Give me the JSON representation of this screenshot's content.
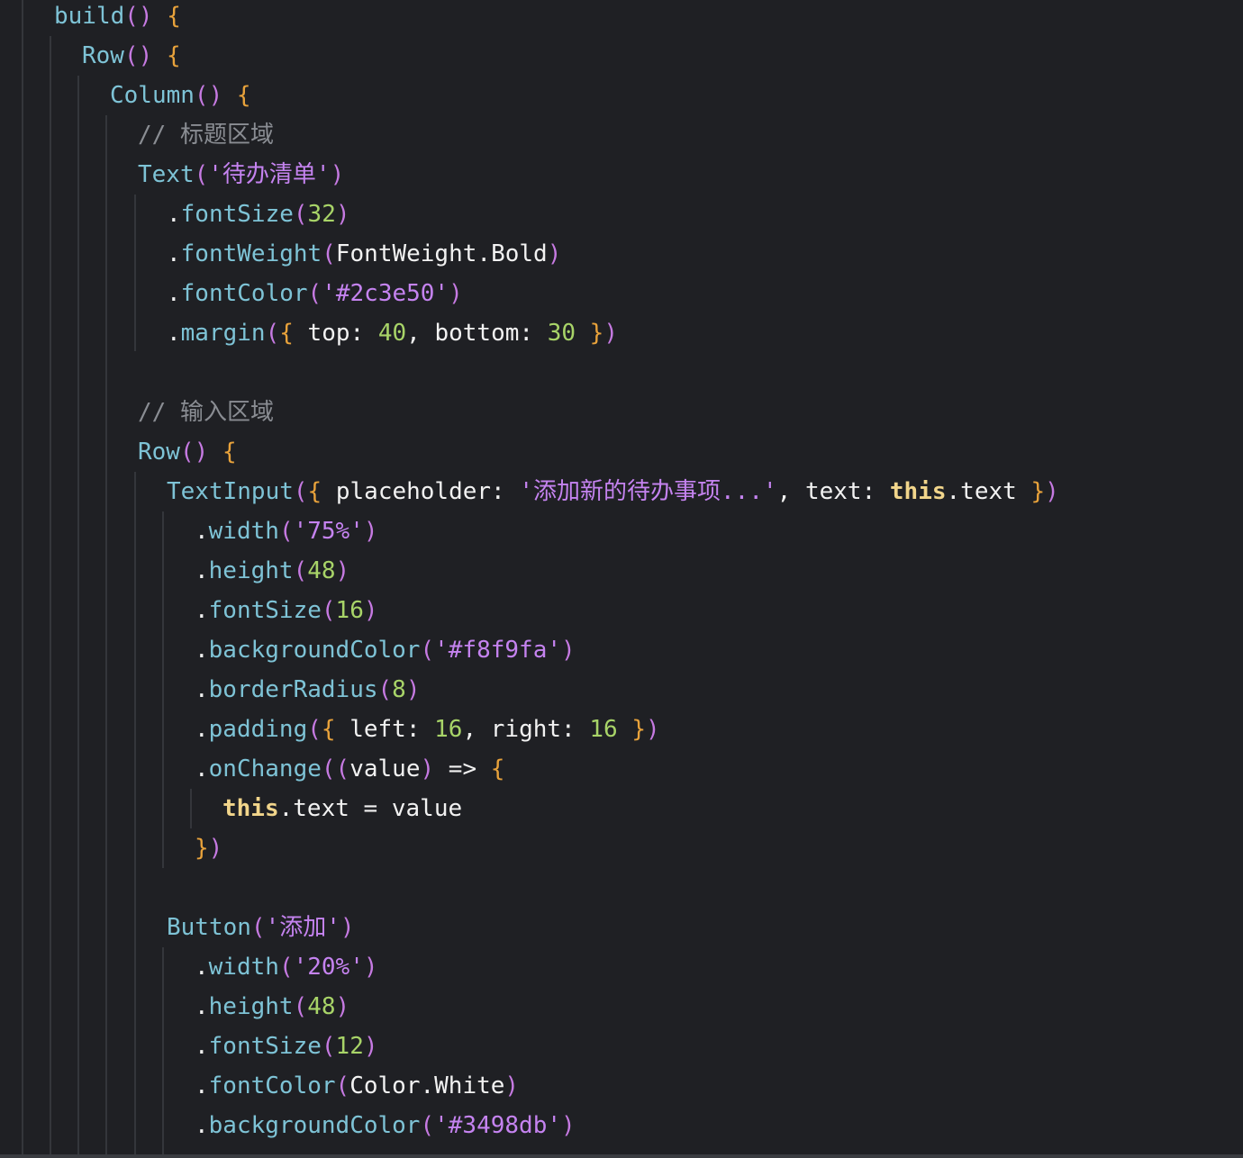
{
  "code_lines": [
    {
      "t": [
        [
          "fn",
          "build"
        ],
        [
          "par",
          "()"
        ],
        [
          "pun",
          " "
        ],
        [
          "br",
          "{"
        ]
      ]
    },
    {
      "t": [
        [
          "fn",
          "Row"
        ],
        [
          "par",
          "()"
        ],
        [
          "pun",
          " "
        ],
        [
          "br",
          "{"
        ]
      ]
    },
    {
      "t": [
        [
          "fn",
          "Column"
        ],
        [
          "par",
          "()"
        ],
        [
          "pun",
          " "
        ],
        [
          "br",
          "{"
        ]
      ]
    },
    {
      "t": [
        [
          "cmt",
          "// 标题区域"
        ]
      ]
    },
    {
      "t": [
        [
          "fn",
          "Text"
        ],
        [
          "par",
          "("
        ],
        [
          "str",
          "'待办清单'"
        ],
        [
          "par",
          ")"
        ]
      ]
    },
    {
      "t": [
        [
          "pun",
          "."
        ],
        [
          "mth",
          "fontSize"
        ],
        [
          "par",
          "("
        ],
        [
          "num",
          "32"
        ],
        [
          "par",
          ")"
        ]
      ]
    },
    {
      "t": [
        [
          "pun",
          "."
        ],
        [
          "mth",
          "fontWeight"
        ],
        [
          "par",
          "("
        ],
        [
          "id",
          "FontWeight"
        ],
        [
          "pun",
          "."
        ],
        [
          "id",
          "Bold"
        ],
        [
          "par",
          ")"
        ]
      ]
    },
    {
      "t": [
        [
          "pun",
          "."
        ],
        [
          "mth",
          "fontColor"
        ],
        [
          "par",
          "("
        ],
        [
          "str",
          "'#2c3e50'"
        ],
        [
          "par",
          ")"
        ]
      ]
    },
    {
      "t": [
        [
          "pun",
          "."
        ],
        [
          "mth",
          "margin"
        ],
        [
          "par",
          "("
        ],
        [
          "br",
          "{"
        ],
        [
          "id",
          " top"
        ],
        [
          "pun",
          ": "
        ],
        [
          "num",
          "40"
        ],
        [
          "pun",
          ", "
        ],
        [
          "id",
          "bottom"
        ],
        [
          "pun",
          ": "
        ],
        [
          "num",
          "30"
        ],
        [
          "pun",
          " "
        ],
        [
          "br",
          "}"
        ],
        [
          "par",
          ")"
        ]
      ]
    },
    {
      "t": []
    },
    {
      "t": [
        [
          "cmt",
          "// 输入区域"
        ]
      ]
    },
    {
      "t": [
        [
          "fn",
          "Row"
        ],
        [
          "par",
          "()"
        ],
        [
          "pun",
          " "
        ],
        [
          "br",
          "{"
        ]
      ]
    },
    {
      "t": [
        [
          "fn",
          "TextInput"
        ],
        [
          "par",
          "("
        ],
        [
          "br",
          "{"
        ],
        [
          "id",
          " placeholder"
        ],
        [
          "pun",
          ": "
        ],
        [
          "str",
          "'添加新的待办事项...'"
        ],
        [
          "pun",
          ", "
        ],
        [
          "id",
          "text"
        ],
        [
          "pun",
          ": "
        ],
        [
          "kw",
          "this"
        ],
        [
          "pun",
          "."
        ],
        [
          "id",
          "text"
        ],
        [
          "pun",
          " "
        ],
        [
          "br",
          "}"
        ],
        [
          "par",
          ")"
        ]
      ]
    },
    {
      "t": [
        [
          "pun",
          "."
        ],
        [
          "mth",
          "width"
        ],
        [
          "par",
          "("
        ],
        [
          "str",
          "'75%'"
        ],
        [
          "par",
          ")"
        ]
      ]
    },
    {
      "t": [
        [
          "pun",
          "."
        ],
        [
          "mth",
          "height"
        ],
        [
          "par",
          "("
        ],
        [
          "num",
          "48"
        ],
        [
          "par",
          ")"
        ]
      ]
    },
    {
      "t": [
        [
          "pun",
          "."
        ],
        [
          "mth",
          "fontSize"
        ],
        [
          "par",
          "("
        ],
        [
          "num",
          "16"
        ],
        [
          "par",
          ")"
        ]
      ]
    },
    {
      "t": [
        [
          "pun",
          "."
        ],
        [
          "mth",
          "backgroundColor"
        ],
        [
          "par",
          "("
        ],
        [
          "str",
          "'#f8f9fa'"
        ],
        [
          "par",
          ")"
        ]
      ]
    },
    {
      "t": [
        [
          "pun",
          "."
        ],
        [
          "mth",
          "borderRadius"
        ],
        [
          "par",
          "("
        ],
        [
          "num",
          "8"
        ],
        [
          "par",
          ")"
        ]
      ]
    },
    {
      "t": [
        [
          "pun",
          "."
        ],
        [
          "mth",
          "padding"
        ],
        [
          "par",
          "("
        ],
        [
          "br",
          "{"
        ],
        [
          "id",
          " left"
        ],
        [
          "pun",
          ": "
        ],
        [
          "num",
          "16"
        ],
        [
          "pun",
          ", "
        ],
        [
          "id",
          "right"
        ],
        [
          "pun",
          ": "
        ],
        [
          "num",
          "16"
        ],
        [
          "pun",
          " "
        ],
        [
          "br",
          "}"
        ],
        [
          "par",
          ")"
        ]
      ]
    },
    {
      "t": [
        [
          "pun",
          "."
        ],
        [
          "mth",
          "onChange"
        ],
        [
          "par",
          "(("
        ],
        [
          "id",
          "value"
        ],
        [
          "par",
          ")"
        ],
        [
          "pun",
          " => "
        ],
        [
          "br",
          "{"
        ]
      ]
    },
    {
      "t": [
        [
          "kw",
          "this"
        ],
        [
          "pun",
          "."
        ],
        [
          "id",
          "text"
        ],
        [
          "pun",
          " = "
        ],
        [
          "id",
          "value"
        ]
      ]
    },
    {
      "t": [
        [
          "br",
          "}"
        ],
        [
          "par",
          ")"
        ]
      ]
    },
    {
      "t": []
    },
    {
      "t": [
        [
          "fn",
          "Button"
        ],
        [
          "par",
          "("
        ],
        [
          "str",
          "'添加'"
        ],
        [
          "par",
          ")"
        ]
      ]
    },
    {
      "t": [
        [
          "pun",
          "."
        ],
        [
          "mth",
          "width"
        ],
        [
          "par",
          "("
        ],
        [
          "str",
          "'20%'"
        ],
        [
          "par",
          ")"
        ]
      ]
    },
    {
      "t": [
        [
          "pun",
          "."
        ],
        [
          "mth",
          "height"
        ],
        [
          "par",
          "("
        ],
        [
          "num",
          "48"
        ],
        [
          "par",
          ")"
        ]
      ]
    },
    {
      "t": [
        [
          "pun",
          "."
        ],
        [
          "mth",
          "fontSize"
        ],
        [
          "par",
          "("
        ],
        [
          "num",
          "12"
        ],
        [
          "par",
          ")"
        ]
      ]
    },
    {
      "t": [
        [
          "pun",
          "."
        ],
        [
          "mth",
          "fontColor"
        ],
        [
          "par",
          "("
        ],
        [
          "id",
          "Color"
        ],
        [
          "pun",
          "."
        ],
        [
          "id",
          "White"
        ],
        [
          "par",
          ")"
        ]
      ]
    },
    {
      "t": [
        [
          "pun",
          "."
        ],
        [
          "mth",
          "backgroundColor"
        ],
        [
          "par",
          "("
        ],
        [
          "str",
          "'#3498db'"
        ],
        [
          "par",
          ")"
        ]
      ]
    }
  ]
}
